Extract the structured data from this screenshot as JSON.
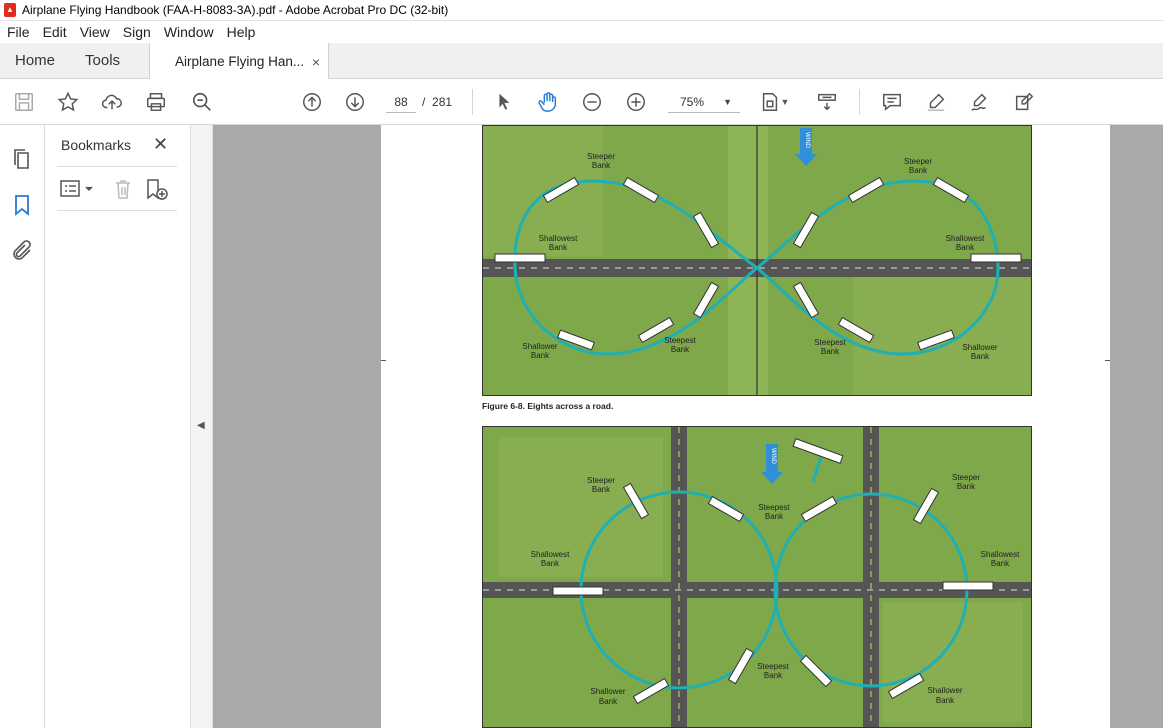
{
  "window": {
    "title": "Airplane Flying Handbook (FAA-H-8083-3A).pdf - Adobe Acrobat Pro DC (32-bit)"
  },
  "menu": [
    "File",
    "Edit",
    "View",
    "Sign",
    "Window",
    "Help"
  ],
  "tabs": {
    "home": "Home",
    "tools": "Tools",
    "document": "Airplane Flying Han...",
    "close": "×"
  },
  "toolbar": {
    "page_current": "88",
    "page_separator": "/",
    "page_total": "281",
    "zoom": "75%"
  },
  "bookmarks": {
    "title": "Bookmarks",
    "close": "✕"
  },
  "figure1": {
    "caption": "Figure 6-8. Eights across a road.",
    "wind_label": "WIND",
    "labels": {
      "steeper_left": [
        "Steeper",
        "Bank"
      ],
      "steeper_right": [
        "Steeper",
        "Bank"
      ],
      "shallowest_left": [
        "Shallowest",
        "Bank"
      ],
      "shallowest_right": [
        "Shallowest",
        "Bank"
      ],
      "shallower_left": [
        "Shallower",
        "Bank"
      ],
      "shallower_right": [
        "Shallower",
        "Bank"
      ],
      "steepest_left": [
        "Steepest",
        "Bank"
      ],
      "steepest_right": [
        "Steepest",
        "Bank"
      ]
    }
  },
  "figure2": {
    "wind_label": "WIND",
    "labels": {
      "steeper_left": [
        "Steeper",
        "Bank"
      ],
      "steeper_right": [
        "Steeper",
        "Bank"
      ],
      "steepest_top": [
        "Steepest",
        "Bank"
      ],
      "shallowest_left": [
        "Shallowest",
        "Bank"
      ],
      "shallowest_right": [
        "Shallowest",
        "Bank"
      ],
      "steepest_bottom": [
        "Steepest",
        "Bank"
      ],
      "shallower_left": [
        "Shallower",
        "Bank"
      ],
      "shallower_right": [
        "Shallower",
        "Bank"
      ]
    }
  },
  "colors": {
    "grass": "#7fa84a",
    "track": "#1fb0b4",
    "road": "#555555",
    "wind_arrow": "#2f8fd8"
  }
}
